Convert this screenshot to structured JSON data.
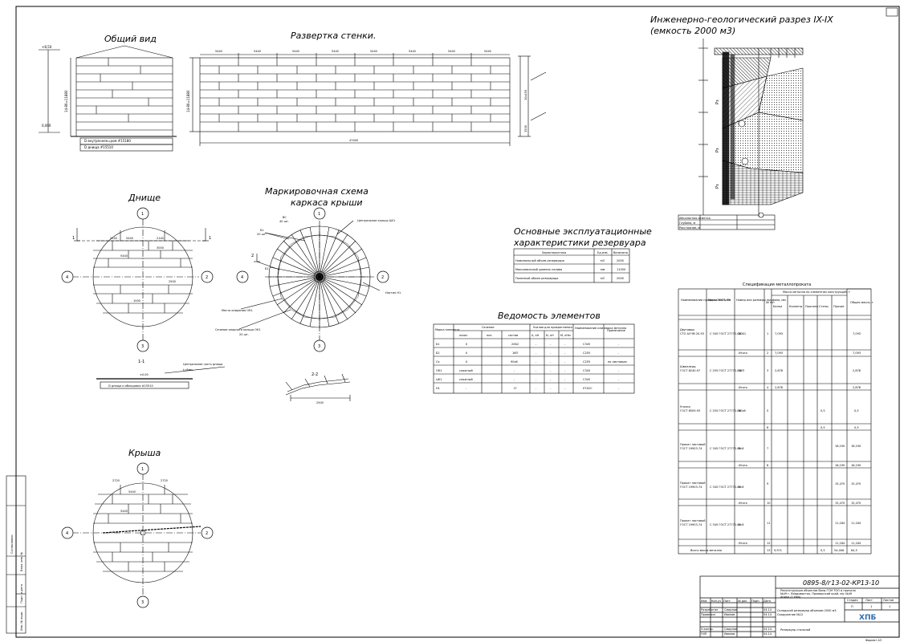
{
  "views": {
    "general_view": "Общий вид",
    "wall_development": "Развертка стенки.",
    "bottom": "Днище",
    "roof": "Крыша",
    "roof_scheme_1": "Маркировочная схема",
    "roof_scheme_2": "каркаса крыши",
    "section_1_1": "1-1",
    "section_2_2": "2-2"
  },
  "dims": {
    "mark_top": "+8,50",
    "mark_bottom": "0,000",
    "height": "14·80=11880",
    "inner_diameter": "D внутреннее=ром #15180",
    "bottom_diameter": "D днища #15510",
    "outer_diameter": "D днища и облицовки #15510",
    "segment": "5440",
    "total_length": "47400",
    "side_dim": "10х150",
    "side_small": "1500",
    "bottom_a": "2140",
    "bottom_b": "3000",
    "bottom_c": "2500",
    "bottom_d": "1000",
    "roof_a": "2720",
    "mark_section": "±0,00",
    "section_2_2": "2500"
  },
  "axes": {
    "a1": "1",
    "a2": "2",
    "a3": "3",
    "a4": "4",
    "cut": "1"
  },
  "notes": {
    "central_bottom_part": "Центральная часть днища",
    "thickness_bottom": "t=6мм"
  },
  "roof": {
    "bc_mark": "ВС",
    "bc_count": "40 шт.",
    "b1_mark": "Б1",
    "b1_count": "20 шт.",
    "central_ring": "Центральное кольцо ЦК1",
    "cut_2": "2",
    "deck": "Настил Н1",
    "ring_ok1_place": "Место опирания ОК1",
    "ring_ok1_section": "Сечение опорного кольца ОК1",
    "ring_count": "20 шт."
  },
  "characteristics": {
    "title_1": "Основные эксплуатационные",
    "title_2": "характеристики резервуара",
    "headers": [
      "Характеристика",
      "Ед.изм.",
      "Величина"
    ],
    "rows": [
      {
        "name": "Номинальный объем резервуара",
        "unit": "м3",
        "value": "2000"
      },
      {
        "name": "Максимальный уровень налива",
        "unit": "мм",
        "value": "11000"
      },
      {
        "name": "Полезный объем резервуара",
        "unit": "м3",
        "value": "2000"
      }
    ]
  },
  "elements": {
    "title": "Ведомость элементов",
    "headers": {
      "mark": "Марка элемента",
      "section": "Сечение",
      "forces": "Усилия для прикрепления",
      "steel": "Наименование или марка металла",
      "note": "Примечание",
      "sketch": "эскиз",
      "pos": "поз.",
      "composition": "состав",
      "a": "А, кН",
      "n": "N, кН",
      "m": "М, кНм"
    },
    "rows": [
      {
        "mark": "Б1",
        "sketch": "0",
        "composition": "20Б2",
        "a": "-",
        "n": "-",
        "m": "-",
        "steel": "С345",
        "note": "-"
      },
      {
        "mark": "Б2",
        "sketch": "0",
        "composition": "16П",
        "a": "-",
        "n": "-",
        "m": "-",
        "steel": "С255",
        "note": "-"
      },
      {
        "mark": "Сх",
        "sketch": "0",
        "composition": "90х6",
        "a": "-",
        "n": "-",
        "m": "-",
        "steel": "С255",
        "note": "по листовым"
      },
      {
        "mark": "ОК1",
        "sketch": "сложный",
        "composition": "-",
        "a": "-",
        "n": "-",
        "m": "-",
        "steel": "С345",
        "note": "-"
      },
      {
        "mark": "ЦК1",
        "sketch": "сложный",
        "composition": "-",
        "a": "-",
        "n": "-",
        "m": "-",
        "steel": "С345",
        "note": "-"
      },
      {
        "mark": "Н1",
        "sketch": "-",
        "composition": "t7",
        "a": "-",
        "n": "-",
        "m": "-",
        "steel": "07Х2С",
        "note": "-"
      }
    ]
  },
  "geology": {
    "title_1": "Инженерно-геологический разрез IX-IX",
    "title_2": "(емкость 2000 м3)",
    "layer_1": "Рз",
    "layer_2": "Рз",
    "layer_3": "Рз",
    "legend": [
      "Абсолютная отметка",
      "Глубина, м",
      "Расстояние, м"
    ]
  },
  "specification": {
    "title": "Спецификация металлопроката",
    "headers": [
      "Наименование профиля ГОСТ, ТУ",
      "Марка металла",
      "Номер или размеры профиля, мм",
      "№ п/п",
      "Масса металла по элементам конструкций, т",
      "Балки",
      "Колонны",
      "Прогоны",
      "Стены",
      "Прочие",
      "Общая масса, т"
    ],
    "total_label": "Итого",
    "rows": [
      {
        "name": "Двутавры",
        "std": "СТО АСЧМ 20-93",
        "grade": "С 345 ГОСТ 27772-88",
        "profile": "20Б1",
        "no": "1",
        "sum_no": "2",
        "beams": "7,093",
        "total": "7,093"
      },
      {
        "name": "Швеллеры",
        "std": "ГОСТ 8240-97",
        "grade": "С 255 ГОСТ 27772-88",
        "profile": "16П",
        "no": "3",
        "sum_no": "4",
        "beams": "2,878",
        "total": "2,878"
      },
      {
        "name": "Уголки",
        "std": "ГОСТ 8509-93",
        "grade": "С 255 ГОСТ 27772-88",
        "profile": "90х6",
        "no": "5",
        "sum_no": "6",
        "wall": "0,5",
        "total": "0,5"
      },
      {
        "name": "Прокат листовой",
        "std": "ГОСТ 19903-74",
        "grade": "С 345 ГОСТ 27772-88",
        "profile": "t=6",
        "no": "7",
        "sum_no": "8",
        "other": "18,190",
        "total": "18,190"
      },
      {
        "name": "Прокат листовой",
        "std": "ГОСТ 19903-74",
        "grade": "С 345 ГОСТ 27772-88",
        "profile": "t=6",
        "no": "9",
        "sum_no": "10",
        "other": "15,470",
        "total": "15,470"
      },
      {
        "name": "Прокат листовой",
        "std": "ГОСТ 19903-74",
        "grade": "С 345 ГОСТ 27772-88",
        "profile": "t=6",
        "no": "11",
        "sum_no": "12",
        "other": "11,184",
        "total": "11,184"
      }
    ],
    "grand_total": {
      "label": "Всего масса металла",
      "no": "13",
      "beams": "9,971",
      "wall": "0,5",
      "other": "54,006",
      "total": "64,5"
    }
  },
  "stamp_left": {
    "agreed": "Согласовано",
    "inv_replaced": "Взам. инв. №",
    "sign_date": "Подп. и дата",
    "inv_original": "Инв. № подл."
  },
  "title_block": {
    "code": "0895-8/г13-02-КР13-10",
    "project_1": "Реконструкция объектов базы ГСМ ТОО и причала",
    "project_2": "№49 г. Владивосток, Приморский край, м/с №49",
    "project_3": "Аника (г.Уфа)",
    "sheet_name_1": "Складской резервуар объемом 2000 м3.",
    "sheet_name_2": "Сооружение №12",
    "stage_label": "Стадия",
    "sheet_label": "Лист",
    "sheets_label": "Листов",
    "stage": "П",
    "sheet": "1",
    "sheets": "1",
    "company": "ХПБ",
    "drawing_type": "Резервуар стальной",
    "format": "Формат А3",
    "cols": [
      "Изм.",
      "Кол.уч",
      "Лист",
      "№ док.",
      "Подп.",
      "Дата"
    ],
    "roles": [
      "Разработал",
      "Проверил",
      "Н.контр.",
      "ГИП"
    ],
    "names": [
      "Смирнов",
      "Иванов",
      "Смирнов",
      "Иванов"
    ],
    "dates": [
      "04.14"
    ]
  }
}
